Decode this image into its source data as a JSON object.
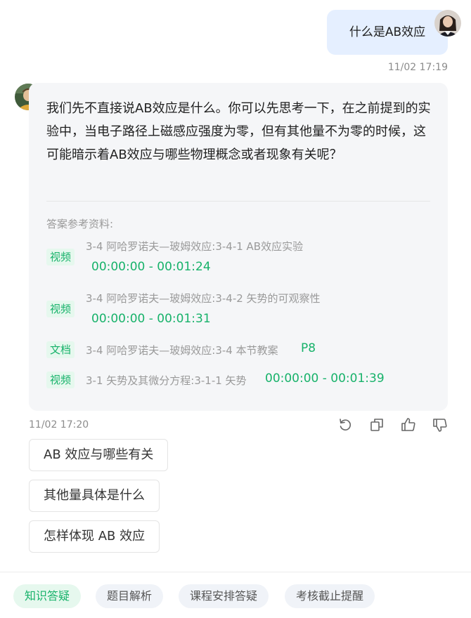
{
  "user_message": {
    "text": "什么是AB效应",
    "time": "11/02 17:19"
  },
  "bot_message": {
    "text": "我们先不直接说AB效应是什么。你可以先思考一下，在之前提到的实验中，当电子路径上磁感应强度为零，但有其他量不为零的时候，这可能暗示着AB效应与哪些物理概念或者现象有关呢？",
    "time": "11/02 17:20",
    "references_title": "答案参考资料:",
    "references": [
      {
        "tag": "视频",
        "name": "3-4 阿哈罗诺夫—玻姆效应:3-4-1 AB效应实验",
        "time": "00:00:00 - 00:01:24"
      },
      {
        "tag": "视频",
        "name": "3-4 阿哈罗诺夫—玻姆效应:3-4-2 矢势的可观察性",
        "time": "00:00:00 - 00:01:31"
      },
      {
        "tag": "文档",
        "name": "3-4 阿哈罗诺夫—玻姆效应:3-4 本节教案",
        "time": "P8"
      },
      {
        "tag": "视频",
        "name": "3-1 矢势及其微分方程:3-1-1 矢势",
        "time": "00:00:00 - 00:01:39"
      }
    ]
  },
  "suggestions": [
    "AB 效应与哪些有关",
    "其他量具体是什么",
    "怎样体现 AB 效应"
  ],
  "footer_tabs": [
    "知识答疑",
    "题目解析",
    "课程安排答疑",
    "考核截止提醒"
  ],
  "colors": {
    "accent_green": "#17b26a",
    "user_bubble": "#e5efff",
    "bot_bubble": "#f5f6f8"
  },
  "icons": [
    "refresh-icon",
    "copy-icon",
    "thumbs-up-icon",
    "thumbs-down-icon"
  ]
}
